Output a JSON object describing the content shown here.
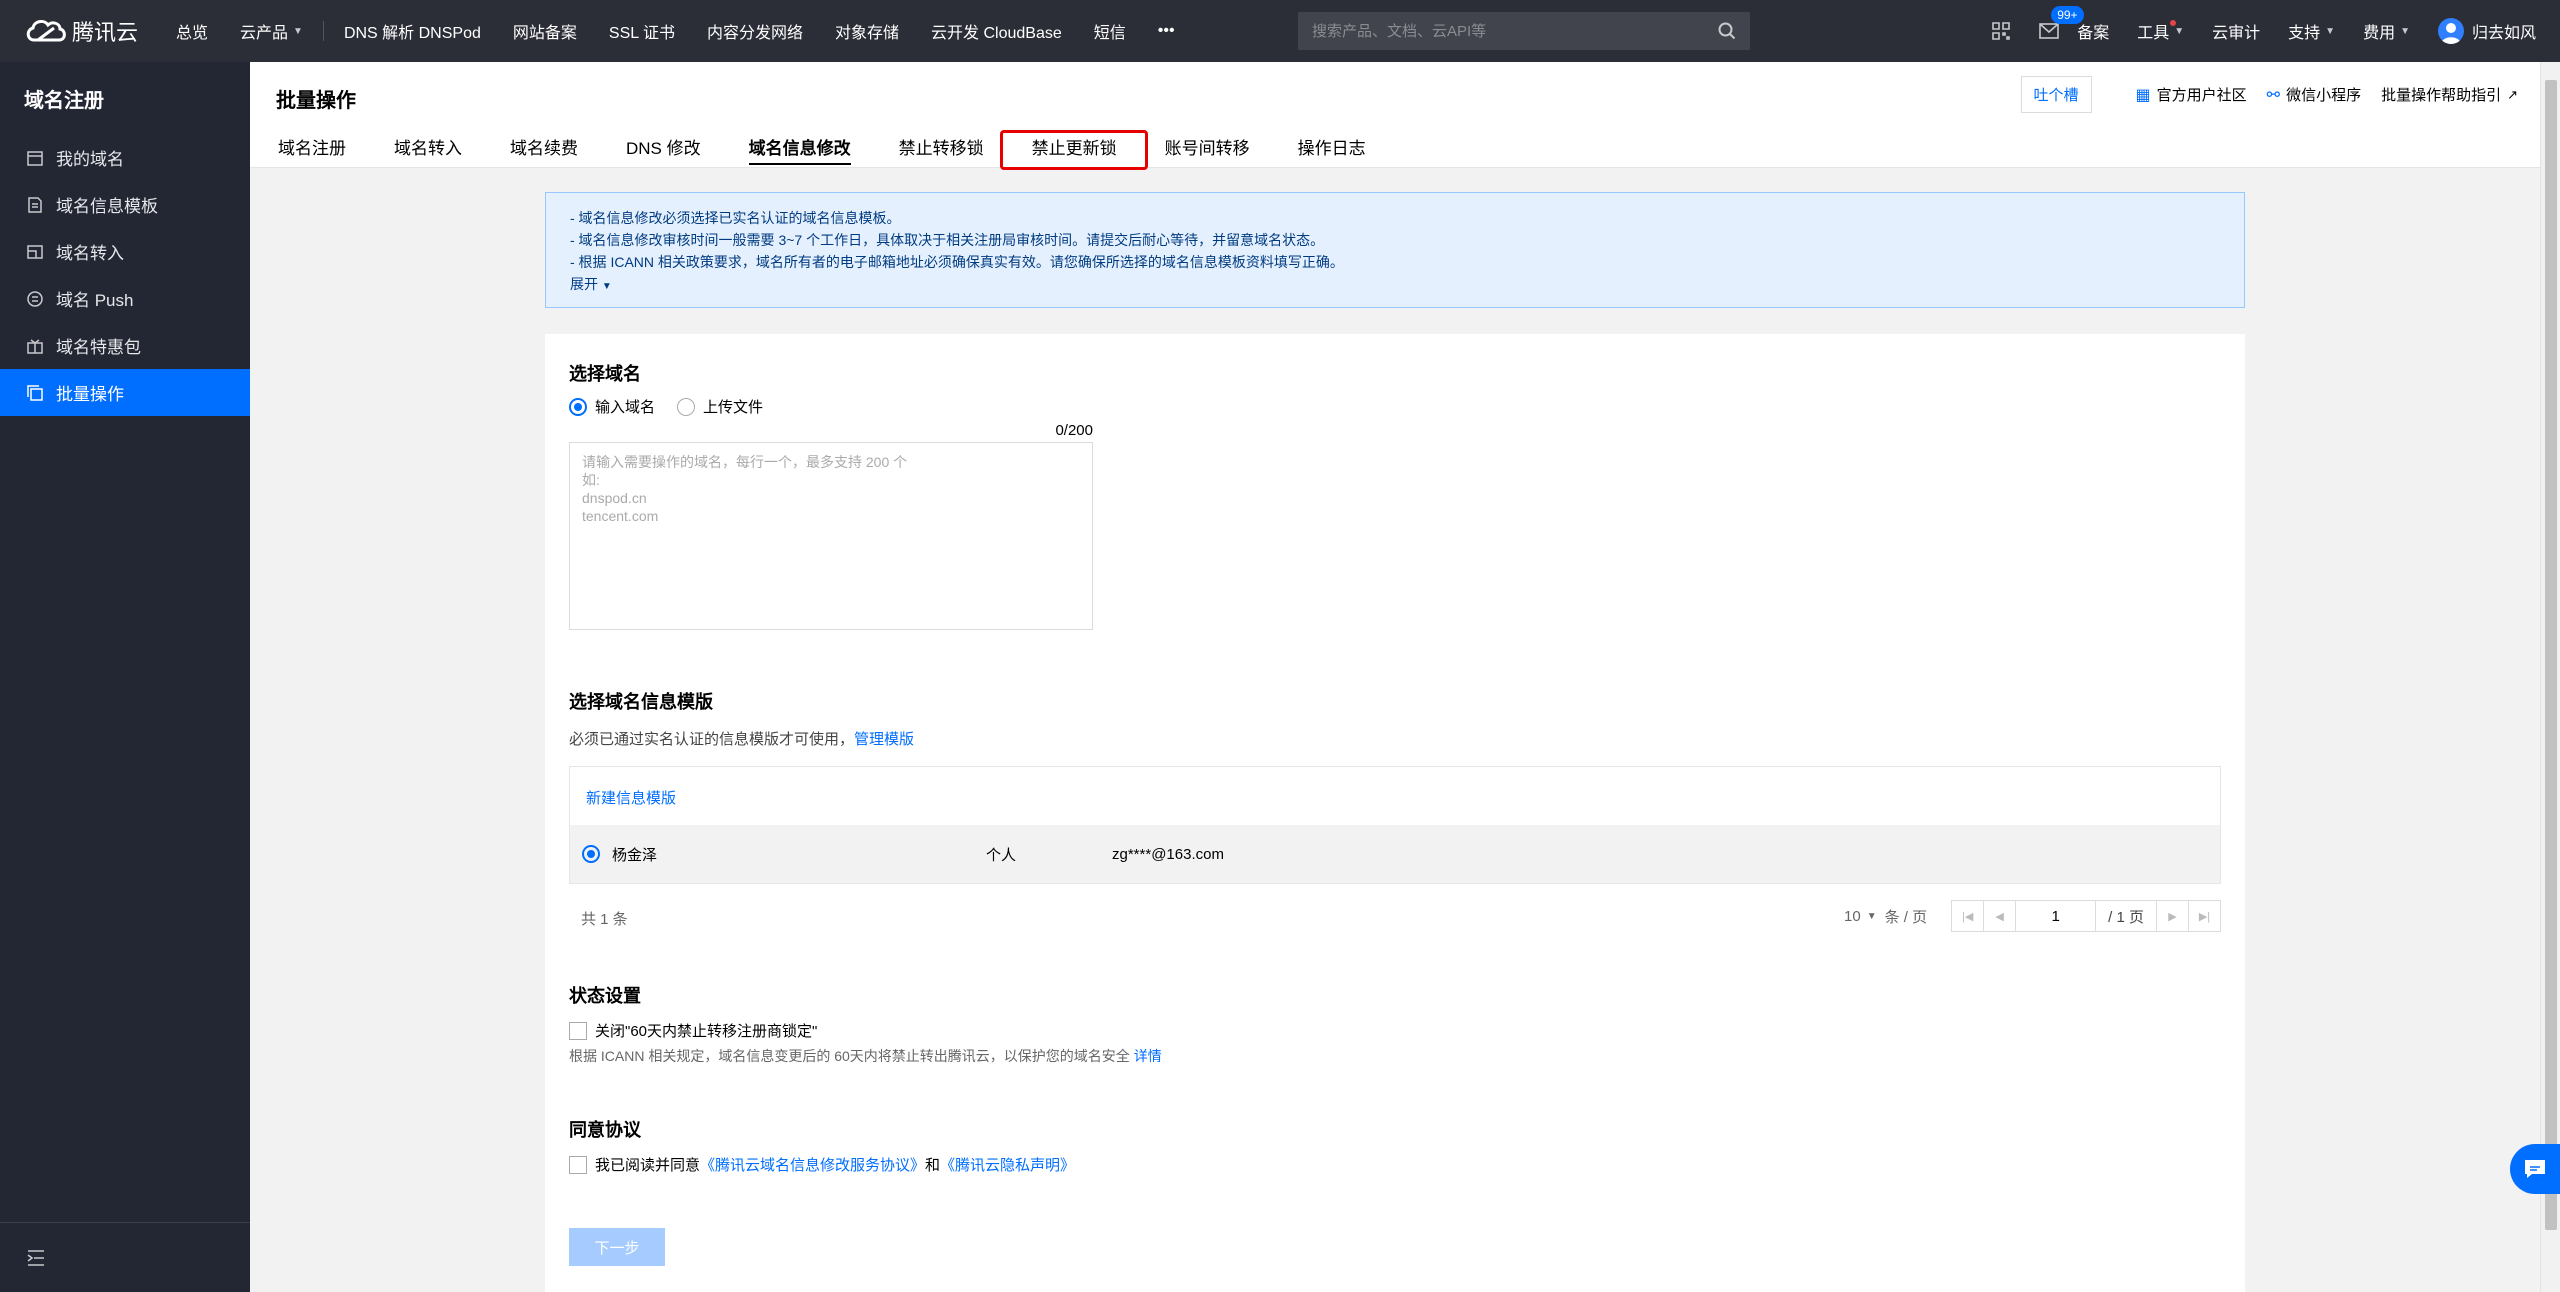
{
  "topbar": {
    "logo_text": "腾讯云",
    "nav": [
      {
        "label": "总览",
        "caret": false
      },
      {
        "label": "云产品",
        "caret": true
      },
      {
        "label": "DNS 解析 DNSPod",
        "caret": false
      },
      {
        "label": "网站备案",
        "caret": false
      },
      {
        "label": "SSL 证书",
        "caret": false
      },
      {
        "label": "内容分发网络",
        "caret": false
      },
      {
        "label": "对象存储",
        "caret": false
      },
      {
        "label": "云开发 CloudBase",
        "caret": false
      },
      {
        "label": "短信",
        "caret": false
      }
    ],
    "more": "•••",
    "search_placeholder": "搜索产品、文档、云API等",
    "right": {
      "badge": "99+",
      "beian": "备案",
      "gongju": "工具",
      "shenji": "云审计",
      "zhichi": "支持",
      "feiyong": "费用",
      "user": "归去如风"
    }
  },
  "sidebar": {
    "title": "域名注册",
    "items": [
      {
        "label": "我的域名",
        "icon": "calendar-icon"
      },
      {
        "label": "域名信息模板",
        "icon": "document-icon"
      },
      {
        "label": "域名转入",
        "icon": "transfer-icon"
      },
      {
        "label": "域名 Push",
        "icon": "push-icon"
      },
      {
        "label": "域名特惠包",
        "icon": "gift-icon"
      },
      {
        "label": "批量操作",
        "icon": "copy-icon"
      }
    ],
    "active_index": 5
  },
  "header": {
    "title": "批量操作",
    "tabs": [
      "域名注册",
      "域名转入",
      "域名续费",
      "DNS 修改",
      "域名信息修改",
      "禁止转移锁",
      "禁止更新锁",
      "账号间转移",
      "操作日志"
    ],
    "active_tab": 4,
    "feedback": "吐个槽",
    "community": "官方用户社区",
    "miniapp": "微信小程序",
    "help": "批量操作帮助指引"
  },
  "notice": {
    "lines": [
      "- 域名信息修改必须选择已实名认证的域名信息模板。",
      "- 域名信息修改审核时间一般需要 3~7 个工作日，具体取决于相关注册局审核时间。请提交后耐心等待，并留意域名状态。",
      "- 根据 ICANN 相关政策要求，域名所有者的电子邮箱地址必须确保真实有效。请您确保所选择的域名信息模板资料填写正确。"
    ],
    "expand": "展开"
  },
  "select_domain": {
    "title": "选择域名",
    "radio_input": "输入域名",
    "radio_upload": "上传文件",
    "counter": "0/200",
    "placeholder": "请输入需要操作的域名，每行一个，最多支持 200 个\n如:\ndnspod.cn\ntencent.com"
  },
  "template": {
    "title": "选择域名信息模版",
    "hint": "必须已通过实名认证的信息模版才可使用，",
    "manage": "管理模版",
    "new": "新建信息模版",
    "row": {
      "name": "杨金泽",
      "type": "个人",
      "email": "zg****@163.com"
    }
  },
  "pager": {
    "total": "共 1 条",
    "size": "10",
    "size_unit": "条 / 页",
    "page": "1",
    "page_total": "/ 1 页"
  },
  "status": {
    "title": "状态设置",
    "checkbox": "关闭\"60天内禁止转移注册商锁定\"",
    "hint": "根据 ICANN 相关规定，域名信息变更后的 60天内将禁止转出腾讯云，以保护您的域名安全",
    "detail": "详情"
  },
  "agreement": {
    "title": "同意协议",
    "prefix": "我已阅读并同意",
    "link1": "《腾讯云域名信息修改服务协议》",
    "and": "和",
    "link2": "《腾讯云隐私声明》"
  },
  "next": "下一步",
  "colors": {
    "accent": "#006eff",
    "topbar": "#2b2e37",
    "sidebar": "#232734",
    "highlight": "#e60000"
  }
}
